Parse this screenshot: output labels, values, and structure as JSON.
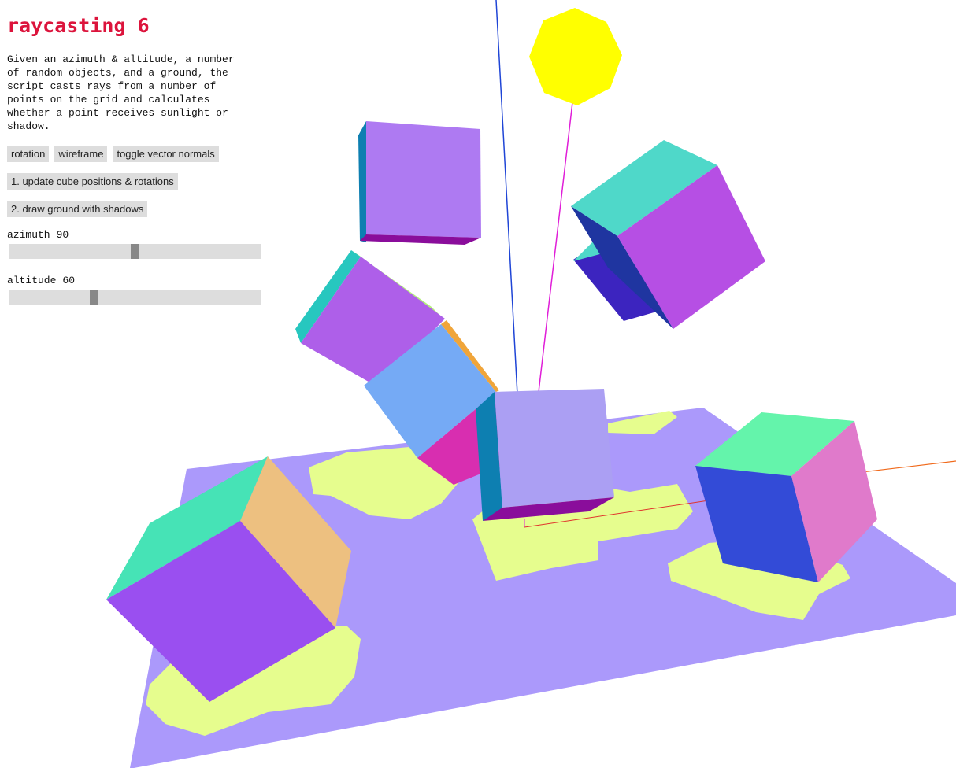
{
  "title": "raycasting 6",
  "description": "Given an azimuth & altitude, a number of random objects, and a ground, the script casts rays from a number of points on the grid and calculates whether a point receives sunlight or shadow.",
  "buttons": {
    "rotation": "rotation",
    "wireframe": "wireframe",
    "toggle_normals": "toggle vector normals",
    "update_cubes": "1. update cube positions & rotations",
    "draw_ground": "2. draw ground with shadows"
  },
  "sliders": {
    "azimuth": {
      "label": "azimuth",
      "value": 90,
      "min": 0,
      "max": 180
    },
    "altitude": {
      "label": "altitude",
      "value": 60,
      "min": 0,
      "max": 180
    }
  },
  "colors": {
    "title": "#dc143c",
    "ground": "#ab99fb",
    "shadow": "#e6fd8e",
    "sun": "#ffff00",
    "axis_y": "#1f45d6",
    "axis_x": "#f06a1c",
    "sun_ray": "#e01ed8"
  }
}
